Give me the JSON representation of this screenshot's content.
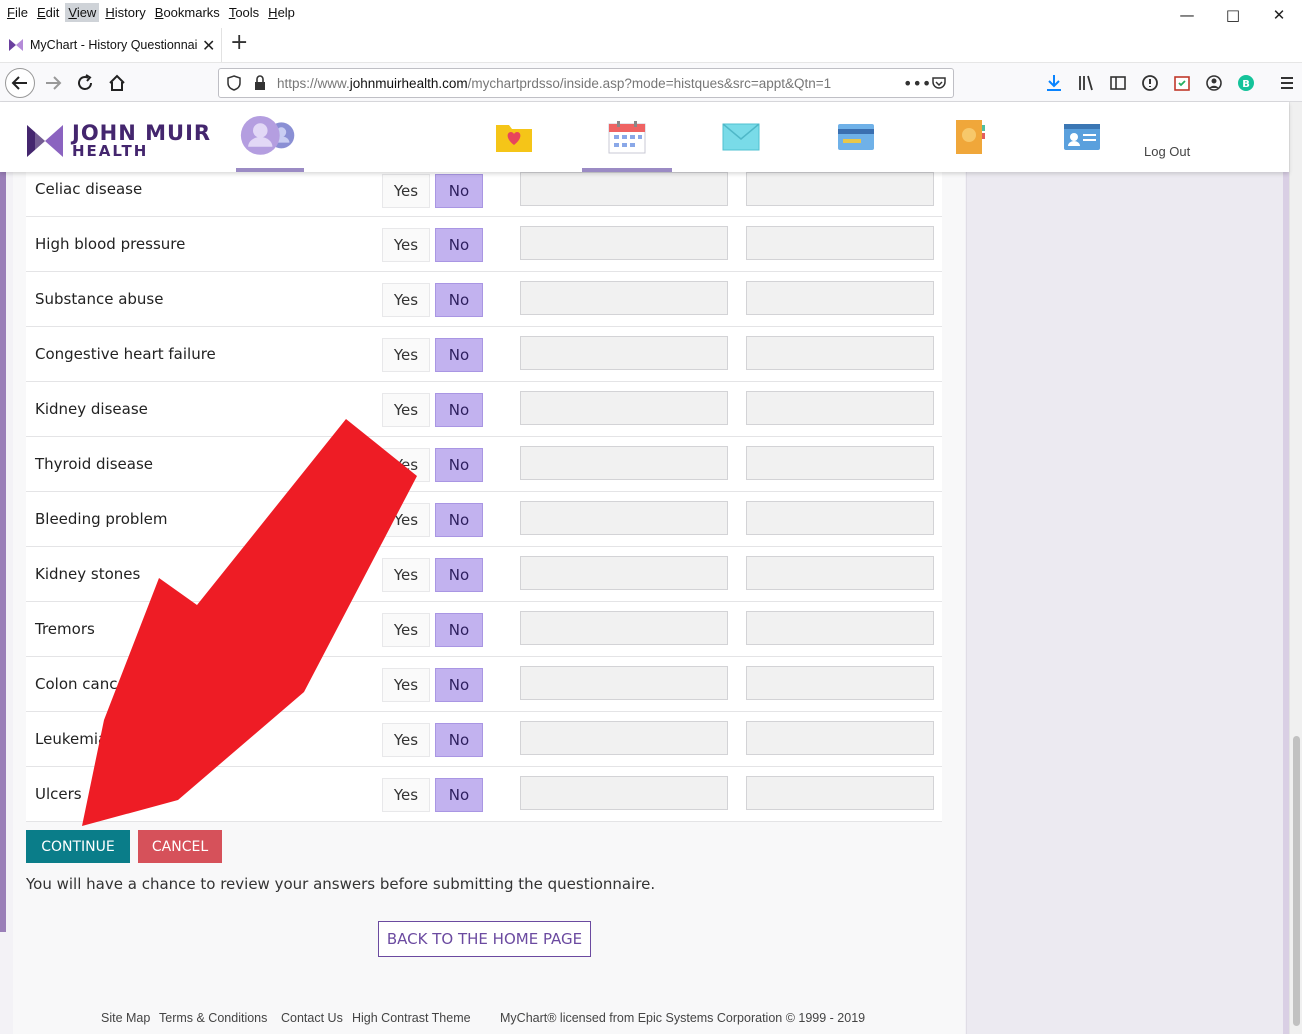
{
  "menu": [
    "File",
    "Edit",
    "View",
    "History",
    "Bookmarks",
    "Tools",
    "Help"
  ],
  "menu_active": "View",
  "tab": {
    "title": "MyChart - History Questionnaire"
  },
  "url": {
    "prefix": "https://www.",
    "domain": "johnmuirhealth.com",
    "path": "/mychartprdsso/inside.asp?mode=histques&src=appt&Qtn=1"
  },
  "brand": {
    "line1": "JOHN MUIR",
    "line2": "HEALTH",
    "color": "#44266e"
  },
  "header": {
    "logout": "Log Out"
  },
  "questions": [
    {
      "label": "Celiac disease",
      "answer": "No"
    },
    {
      "label": "High blood pressure",
      "answer": "No"
    },
    {
      "label": "Substance abuse",
      "answer": "No"
    },
    {
      "label": "Congestive heart failure",
      "answer": "No"
    },
    {
      "label": "Kidney disease",
      "answer": "No"
    },
    {
      "label": "Thyroid disease",
      "answer": "No"
    },
    {
      "label": "Bleeding problem",
      "answer": "No"
    },
    {
      "label": "Kidney stones",
      "answer": "No"
    },
    {
      "label": "Tremors",
      "answer": "No"
    },
    {
      "label": "Colon cancer",
      "answer": "No"
    },
    {
      "label": "Leukemia",
      "answer": "No"
    },
    {
      "label": "Ulcers",
      "answer": "No"
    }
  ],
  "option_yes": "Yes",
  "option_no": "No",
  "actions": {
    "continue": "CONTINUE",
    "cancel": "CANCEL",
    "back_home": "BACK TO THE HOME PAGE"
  },
  "note": "You will have a chance to review your answers before submitting the questionnaire.",
  "footer": {
    "links": [
      "Site Map",
      "Terms & Conditions",
      "Contact Us",
      "High Contrast Theme"
    ],
    "license": "MyChart® licensed from Epic Systems Corporation © 1999 - 2019"
  },
  "colors": {
    "selected": "#c2b2ef",
    "continue": "#0a7d89",
    "cancel": "#d6515a",
    "arrow": "#ee1c25"
  }
}
